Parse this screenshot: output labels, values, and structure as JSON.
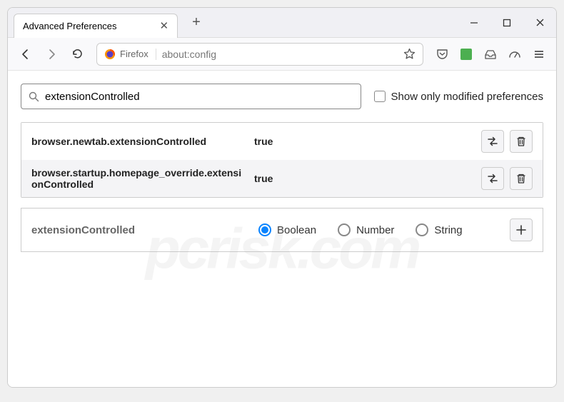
{
  "window": {
    "tab_title": "Advanced Preferences"
  },
  "toolbar": {
    "identity_label": "Firefox",
    "url": "about:config"
  },
  "search": {
    "value": "extensionControlled",
    "checkbox_label": "Show only modified preferences"
  },
  "prefs": [
    {
      "name": "browser.newtab.extensionControlled",
      "value": "true"
    },
    {
      "name": "browser.startup.homepage_override.extensionControlled",
      "value": "true"
    }
  ],
  "new_pref": {
    "name": "extensionControlled",
    "types": [
      "Boolean",
      "Number",
      "String"
    ],
    "selected": "Boolean"
  },
  "watermark": "pcrisk.com"
}
